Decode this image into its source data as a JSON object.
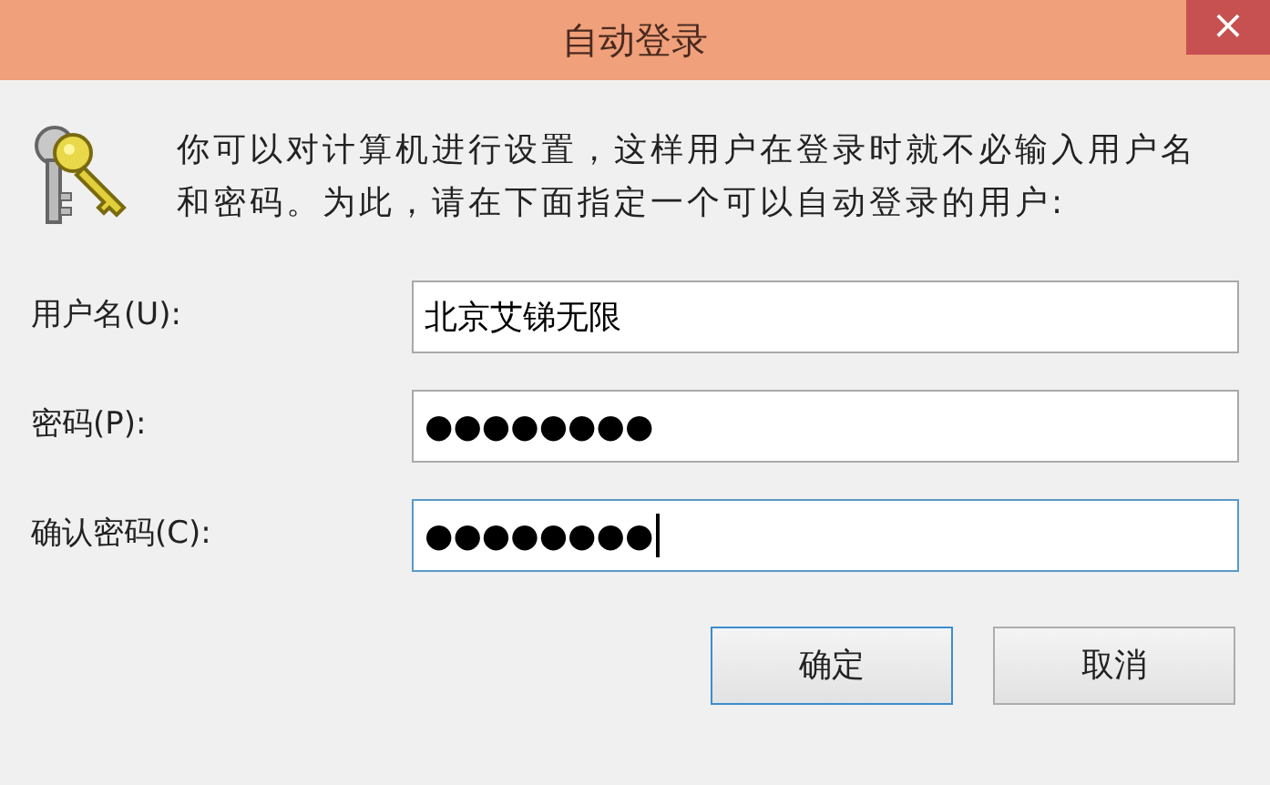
{
  "window": {
    "title": "自动登录",
    "close": "×"
  },
  "description": "你可以对计算机进行设置，这样用户在登录时就不必输入用户名和密码。为此，请在下面指定一个可以自动登录的用户:",
  "fields": [
    {
      "label": "用户名(U):",
      "value": "北京艾锑无限",
      "focused": false
    },
    {
      "label": "密码(P):",
      "value": "●●●●●●●●",
      "focused": false
    },
    {
      "label": "确认密码(C):",
      "value": "●●●●●●●●",
      "focused": true
    }
  ],
  "buttons": [
    {
      "label": "确定",
      "default": true
    },
    {
      "label": "取消",
      "default": false
    }
  ]
}
